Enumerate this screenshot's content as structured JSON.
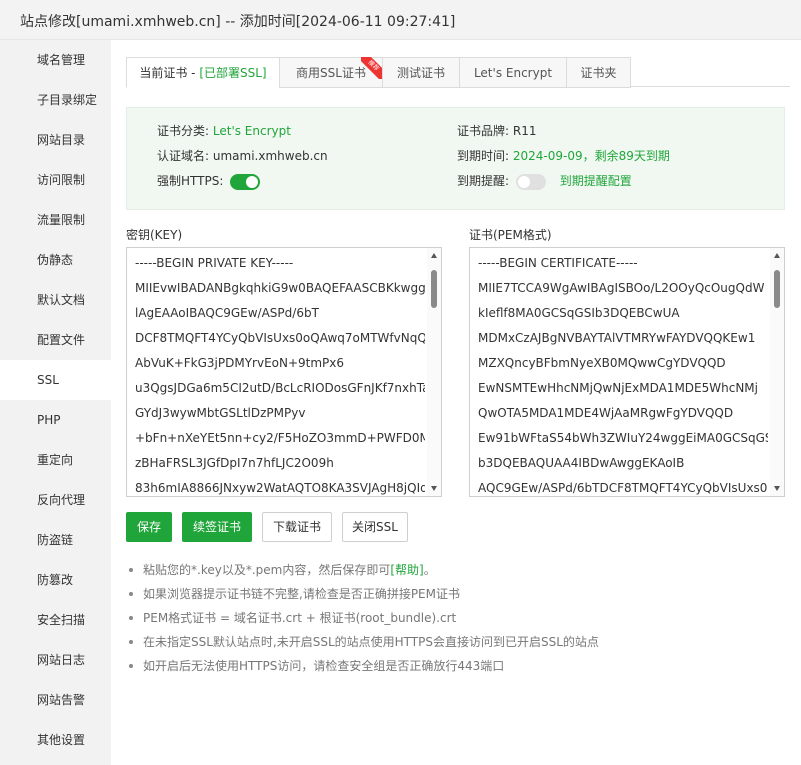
{
  "window": {
    "title": "站点修改[umami.xmhweb.cn] -- 添加时间[2024-06-11 09:27:41]"
  },
  "sidebar": {
    "items": [
      "域名管理",
      "子目录绑定",
      "网站目录",
      "访问限制",
      "流量限制",
      "伪静态",
      "默认文档",
      "配置文件",
      "SSL",
      "PHP",
      "重定向",
      "反向代理",
      "防盗链",
      "防篡改",
      "安全扫描",
      "网站日志",
      "网站告警",
      "其他设置"
    ],
    "active": "SSL"
  },
  "tabs": {
    "current_prefix": "当前证书 - ",
    "current_status": "[已部署SSL]",
    "commercial": "商用SSL证书",
    "commercial_badge": "推荐",
    "test": "测试证书",
    "letsencrypt": "Let's Encrypt",
    "folder": "证书夹"
  },
  "cert_info": {
    "category_label": "证书分类:",
    "category_value": "Let's Encrypt",
    "brand_label": "证书品牌:",
    "brand_value": "R11",
    "domain_label": "认证域名:",
    "domain_value": "umami.xmhweb.cn",
    "expire_label": "到期时间:",
    "expire_value": "2024-09-09，剩余89天到期",
    "force_https_label": "强制HTTPS:",
    "remind_label": "到期提醒:",
    "remind_config": "到期提醒配置"
  },
  "key_field": {
    "label": "密钥(KEY)",
    "lines": [
      "-----BEGIN PRIVATE KEY-----",
      "MIIEvwIBADANBgkqhkiG9w0BAQEFAASCBKkwggS",
      "lAgEAAoIBAQC9GEw/ASPd/6bT",
      "DCF8TMQFT4YCyQbVIsUxs0oQAwq7oMTWfvNqQ",
      "AbVuK+FkG3jPDMYrvEoN+9tmPx6",
      "u3QgsJDGa6m5CI2utD/BcLcRIODosGFnJKf7nxhTa",
      "GYdJ3wywMbtGSLtlDzPMPyv",
      "+bFn+nXeYEt5nn+cy2/F5HoZO3mmD+PWFD0M",
      "zBHaFRSL3JGfDpI7n7hfLJC2O09h",
      "83h6mIA8866JNxyw2WatAQTO8KA3SVJAgH8jQIq"
    ]
  },
  "cert_field": {
    "label": "证书(PEM格式)",
    "lines": [
      "-----BEGIN CERTIFICATE-----",
      "MIIE7TCCA9WgAwIBAgISBOo/L2OOyQcOugQdW",
      "kIeflf8MA0GCSqGSIb3DQEBCwUA",
      "MDMxCzAJBgNVBAYTAlVTMRYwFAYDVQQKEw1",
      "MZXQncyBFbmNyeXB0MQwwCgYDVQQD",
      "EwNSMTEwHhcNMjQwNjExMDA1MDE5WhcNMj",
      "QwOTA5MDA1MDE4WjAaMRgwFgYDVQQD",
      "Ew91bWFtaS54bWh3ZWIuY24wggEiMA0GCSqGSI",
      "b3DQEBAQUAA4IBDwAwggEKAoIB",
      "AQC9GEw/ASPd/6bTDCF8TMQFT4YCyQbVIsUxs0"
    ]
  },
  "buttons": {
    "save": "保存",
    "renew": "续签证书",
    "download": "下载证书",
    "close_ssl": "关闭SSL"
  },
  "tips": {
    "tip1_text": "粘贴您的*.key以及*.pem内容，然后保存即可",
    "tip1_help": "[帮助]",
    "tip1_end": "。",
    "tip2": "如果浏览器提示证书链不完整,请检查是否正确拼接PEM证书",
    "tip3": "PEM格式证书 = 域名证书.crt + 根证书(root_bundle).crt",
    "tip4": "在未指定SSL默认站点时,未开启SSL的站点使用HTTPS会直接访问到已开启SSL的站点",
    "tip5": "如开启后无法使用HTTPS访问，请检查安全组是否正确放行443端口"
  },
  "state": {
    "force_https": true,
    "expire_remind": false
  },
  "colors": {
    "accent": "#20a53a",
    "badge": "#ee3333"
  }
}
